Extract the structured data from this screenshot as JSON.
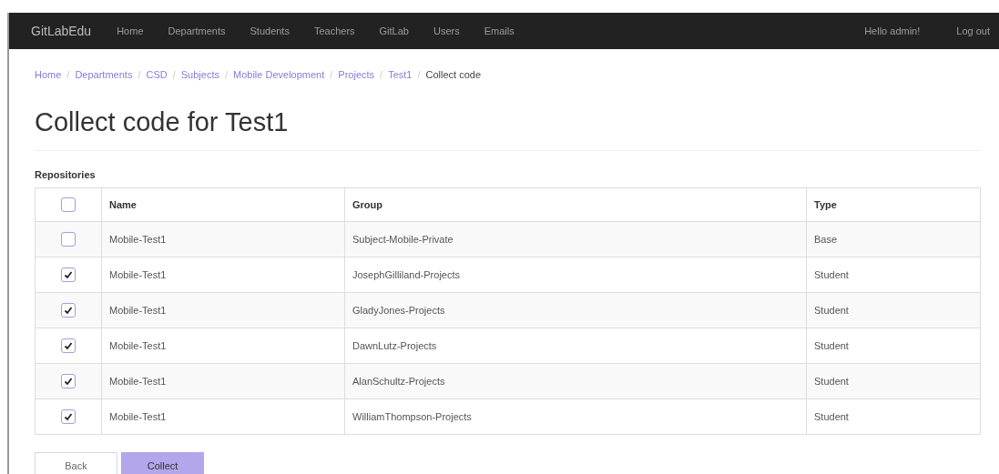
{
  "navbar": {
    "brand": "GitLabEdu",
    "links": [
      "Home",
      "Departments",
      "Students",
      "Teachers",
      "GitLab",
      "Users",
      "Emails"
    ],
    "greeting": "Hello admin!",
    "logout": "Log out"
  },
  "breadcrumb": {
    "links": [
      "Home",
      "Departments",
      "CSD",
      "Subjects",
      "Mobile Development",
      "Projects",
      "Test1"
    ],
    "current": "Collect code",
    "separator": "/"
  },
  "title": "Collect code for Test1",
  "section_label": "Repositories",
  "table": {
    "select_all": {
      "checked": false
    },
    "columns": [
      "Name",
      "Group",
      "Type"
    ],
    "rows": [
      {
        "checked": false,
        "cells": [
          "Mobile-Test1",
          "Subject-Mobile-Private",
          "Base"
        ]
      },
      {
        "checked": true,
        "cells": [
          "Mobile-Test1",
          "JosephGilliland-Projects",
          "Student"
        ]
      },
      {
        "checked": true,
        "cells": [
          "Mobile-Test1",
          "GladyJones-Projects",
          "Student"
        ]
      },
      {
        "checked": true,
        "cells": [
          "Mobile-Test1",
          "DawnLutz-Projects",
          "Student"
        ]
      },
      {
        "checked": true,
        "cells": [
          "Mobile-Test1",
          "AlanSchultz-Projects",
          "Student"
        ]
      },
      {
        "checked": true,
        "cells": [
          "Mobile-Test1",
          "WilliamThompson-Projects",
          "Student"
        ]
      }
    ]
  },
  "buttons": [
    {
      "kind": "secondary",
      "label": "Back"
    },
    {
      "kind": "primary",
      "label": "Collect"
    }
  ]
}
